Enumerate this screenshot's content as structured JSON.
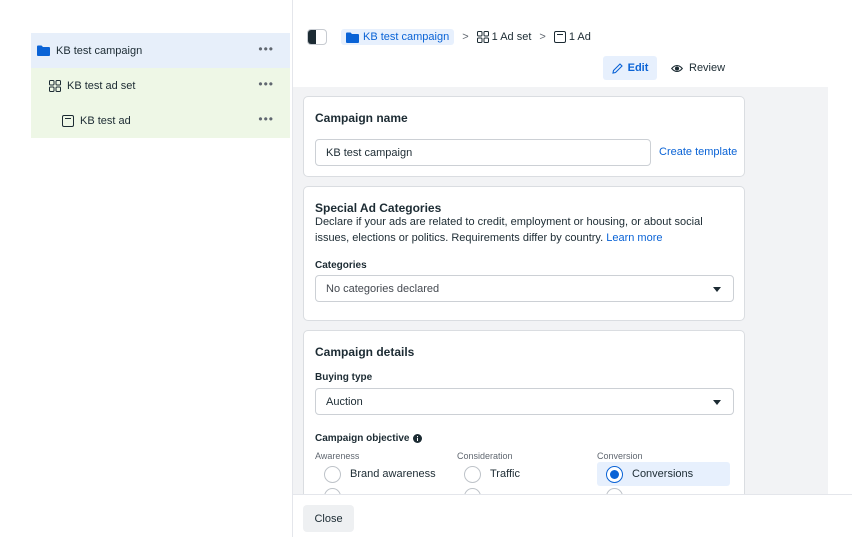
{
  "tree": {
    "campaign": {
      "label": "KB test campaign",
      "more": "•••"
    },
    "adset": {
      "label": "KB test ad set",
      "more": "•••"
    },
    "ad": {
      "label": "KB test ad",
      "more": "•••"
    }
  },
  "breadcrumb": {
    "campaign": "KB test campaign",
    "sep1": ">",
    "adset": "1 Ad set",
    "sep2": ">",
    "ad": "1 Ad"
  },
  "modes": {
    "edit": "Edit",
    "review": "Review"
  },
  "campaign_name": {
    "title": "Campaign name",
    "value": "KB test campaign",
    "create_template": "Create template"
  },
  "special_ad": {
    "title": "Special Ad Categories",
    "desc": "Declare if your ads are related to credit, employment or housing, or about social issues, elections or politics. Requirements differ by country.",
    "learn_more": "Learn more",
    "categories_label": "Categories",
    "categories_value": "No categories declared"
  },
  "details": {
    "title": "Campaign details",
    "buying_type_label": "Buying type",
    "buying_type_value": "Auction",
    "objective_label": "Campaign objective",
    "col_awareness": "Awareness",
    "col_consideration": "Consideration",
    "col_conversion": "Conversion",
    "opt_brand": "Brand awareness",
    "opt_traffic": "Traffic",
    "opt_conversions": "Conversions",
    "selected": "Conversions"
  },
  "footer": {
    "close": "Close"
  },
  "colors": {
    "accent": "#0a63d6",
    "campaign_bg": "#e7effa",
    "adset_bg": "#eef7e6",
    "panel_bg": "#f2f3f5"
  },
  "icons": [
    "folder-icon",
    "adset-grid-icon",
    "ad-square-icon",
    "more-dots-icon",
    "panel-toggle-icon",
    "pencil-icon",
    "eye-icon",
    "info-icon",
    "caret-down-icon"
  ]
}
